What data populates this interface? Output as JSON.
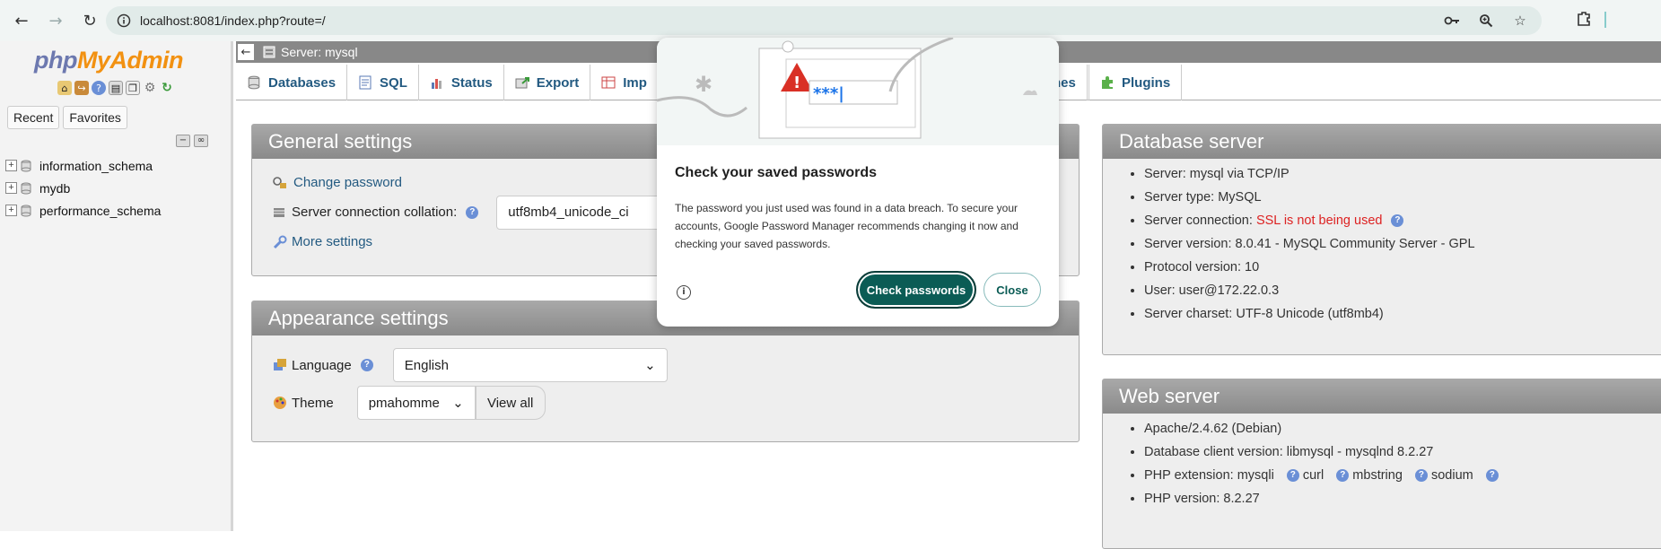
{
  "browser": {
    "url": "localhost:8081/index.php?route=/"
  },
  "logo": {
    "php": "php",
    "my": "My",
    "admin": "Admin"
  },
  "left": {
    "recent_label": "Recent",
    "favorites_label": "Favorites",
    "databases": [
      "information_schema",
      "mydb",
      "performance_schema"
    ]
  },
  "server_bar": {
    "label": "Server: mysql"
  },
  "tabs": [
    {
      "label": "Databases"
    },
    {
      "label": "SQL"
    },
    {
      "label": "Status"
    },
    {
      "label": "Export"
    },
    {
      "label": "Imp"
    },
    {
      "label": "nes"
    },
    {
      "label": "Plugins"
    }
  ],
  "general": {
    "title": "General settings",
    "change_password": "Change password",
    "collation_label": "Server connection collation:",
    "collation_value": "utf8mb4_unicode_ci",
    "more_settings": "More settings"
  },
  "appearance": {
    "title": "Appearance settings",
    "language_label": "Language",
    "language_value": "English",
    "theme_label": "Theme",
    "theme_value": "pmahomme",
    "view_all": "View all"
  },
  "db_server": {
    "title": "Database server",
    "items": [
      "Server: mysql via TCP/IP",
      "Server type: MySQL",
      "Server version: 8.0.41 - MySQL Community Server - GPL",
      "Protocol version: 10",
      "User: user@172.22.0.3",
      "Server charset: UTF-8 Unicode (utf8mb4)"
    ],
    "connection_label": "Server connection: ",
    "connection_value": "SSL is not being used"
  },
  "web_server": {
    "title": "Web server",
    "items": [
      "Apache/2.4.62 (Debian)",
      "Database client version: libmysql - mysqlnd 8.2.27",
      "PHP version: 8.2.27"
    ],
    "php_ext_label": "PHP extension: mysqli",
    "ext_curl": "curl",
    "ext_mbstring": "mbstring",
    "ext_sodium": "sodium"
  },
  "popup": {
    "illus_text": "***|",
    "title": "Check your saved passwords",
    "text": "The password you just used was found in a data breach. To secure your accounts, Google Password Manager recommends changing it now and checking your saved passwords.",
    "primary": "Check passwords",
    "secondary": "Close"
  },
  "colors": {
    "accent": "#0b5c55",
    "link": "#235a81",
    "warning": "#d22"
  }
}
